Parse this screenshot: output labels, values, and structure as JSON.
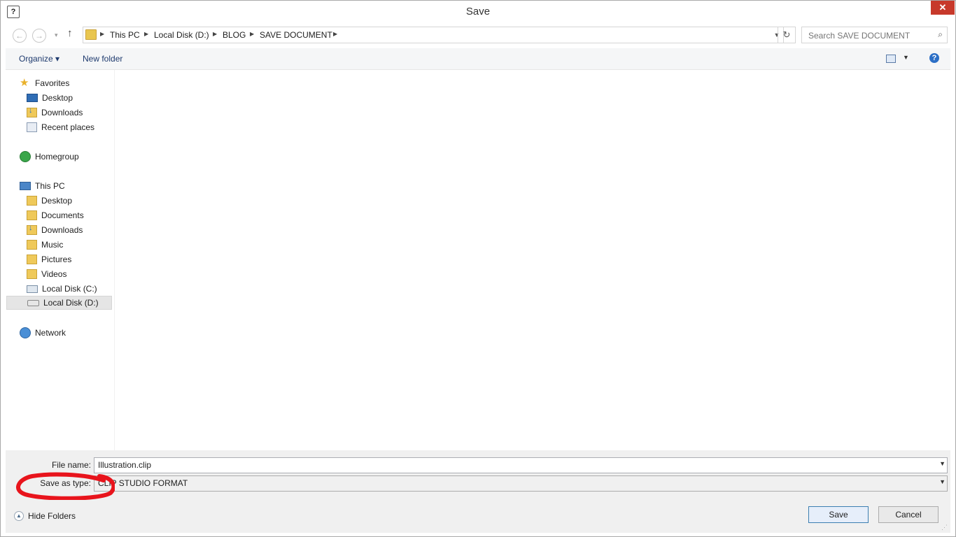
{
  "window": {
    "title": "Save",
    "close_glyph": "✕"
  },
  "nav": {
    "back_glyph": "←",
    "forward_glyph": "→",
    "recent_glyph": "▾",
    "up_glyph": "↑",
    "breadcrumbs": [
      "This PC",
      "Local Disk (D:)",
      "BLOG",
      "SAVE DOCUMENT"
    ],
    "search_placeholder": "Search SAVE DOCUMENT"
  },
  "toolbar": {
    "organize_label": "Organize ▾",
    "new_folder_label": "New folder"
  },
  "navpane": {
    "favorites": {
      "label": "Favorites",
      "items": [
        "Desktop",
        "Downloads",
        "Recent places"
      ]
    },
    "homegroup": {
      "label": "Homegroup"
    },
    "this_pc": {
      "label": "This PC",
      "items": [
        "Desktop",
        "Documents",
        "Downloads",
        "Music",
        "Pictures",
        "Videos",
        "Local Disk (C:)",
        "Local Disk (D:)"
      ],
      "selected": "Local Disk (D:)"
    },
    "network": {
      "label": "Network"
    }
  },
  "form": {
    "file_name_label": "File name:",
    "file_name_value": "Illustration.clip",
    "save_type_label": "Save as type:",
    "save_type_value": "CLIP STUDIO FORMAT"
  },
  "buttons": {
    "save": "Save",
    "cancel": "Cancel",
    "hide_folders": "Hide Folders"
  },
  "annotation": {
    "color": "#e8141c"
  }
}
